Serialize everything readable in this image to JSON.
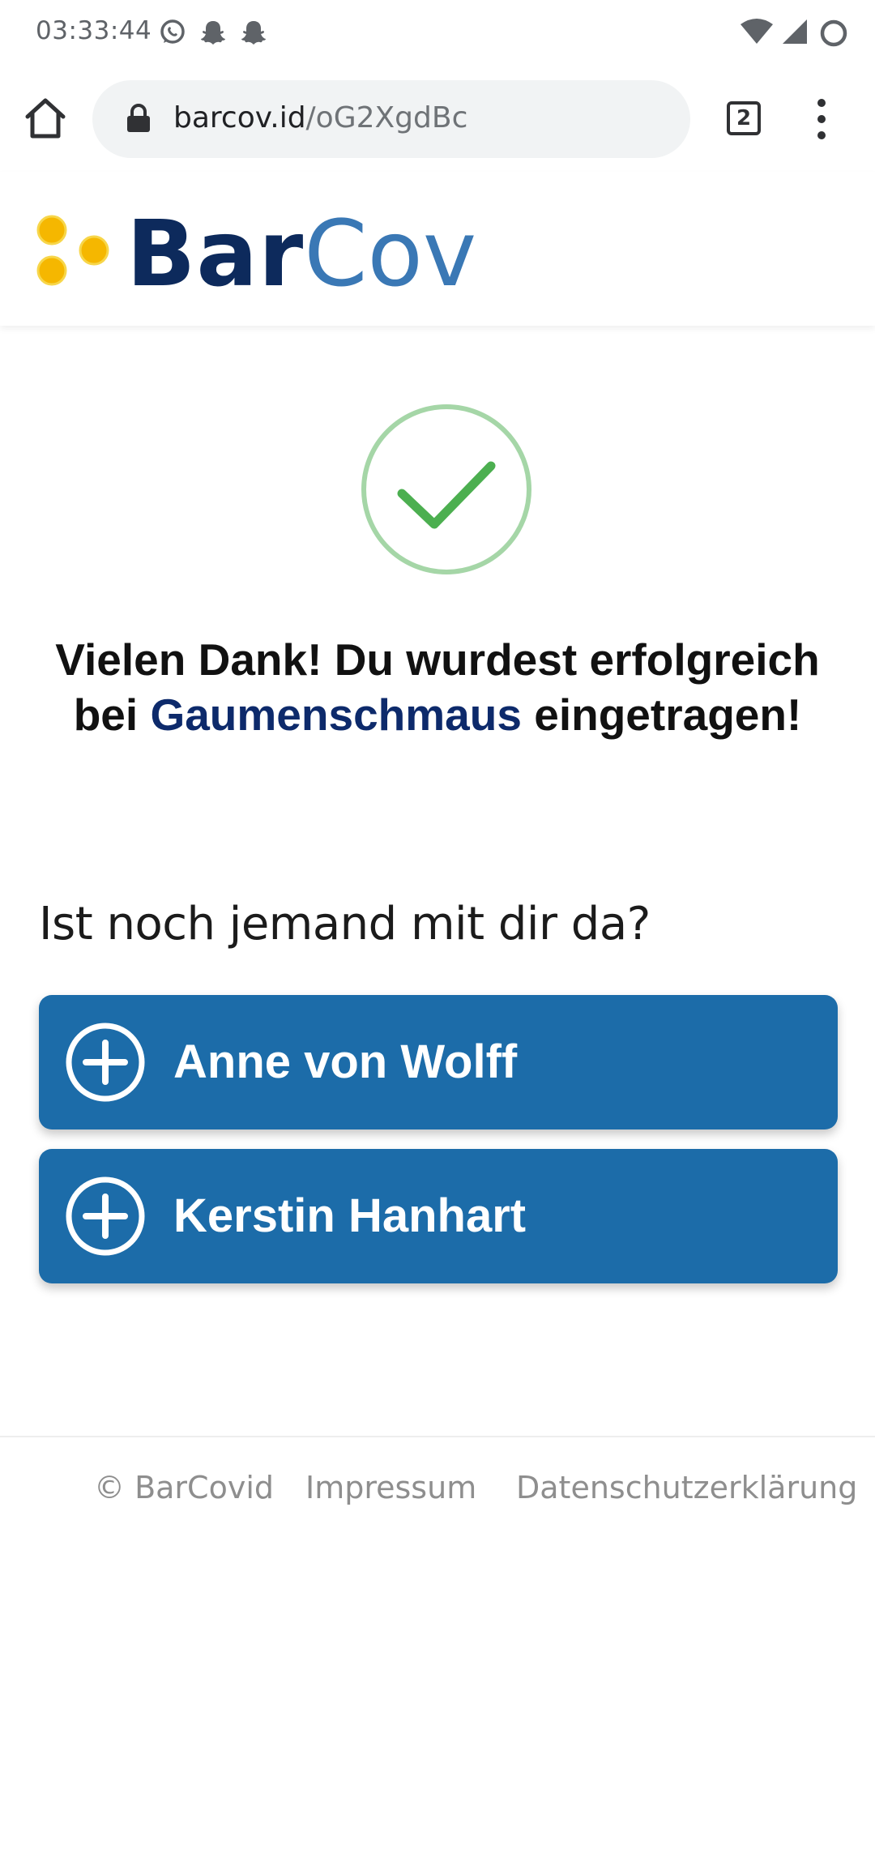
{
  "status_bar": {
    "time": "03:33:44",
    "notification_icons": [
      "whatsapp-icon",
      "snapchat-icon",
      "snapchat-icon"
    ],
    "system_icons": [
      "wifi-icon",
      "signal-icon",
      "battery-icon"
    ]
  },
  "browser": {
    "url_domain": "barcov.id",
    "url_path": "/oG2XgdBc",
    "tab_count": "2"
  },
  "site": {
    "logo_bar": "Bar",
    "logo_cov": "Cov"
  },
  "main": {
    "headline_prefix": "Vielen Dank! Du wurdest erfolgreich bei ",
    "venue": "Gaumenschmaus",
    "headline_suffix": " eingetragen!",
    "question": "Ist noch jemand mit dir da?",
    "companions": [
      {
        "name": "Anne von Wolff"
      },
      {
        "name": "Kerstin Hanhart"
      }
    ]
  },
  "footer": {
    "copyright": "© BarCovid",
    "impressum": "Impressum",
    "privacy": "Datenschutzerklärung"
  },
  "colors": {
    "brand_dark": "#0d2a5c",
    "brand_light": "#3a78b5",
    "button_blue": "#1c6ca9",
    "success_green": "#4caf50",
    "logo_yellow": "#f5b700"
  }
}
